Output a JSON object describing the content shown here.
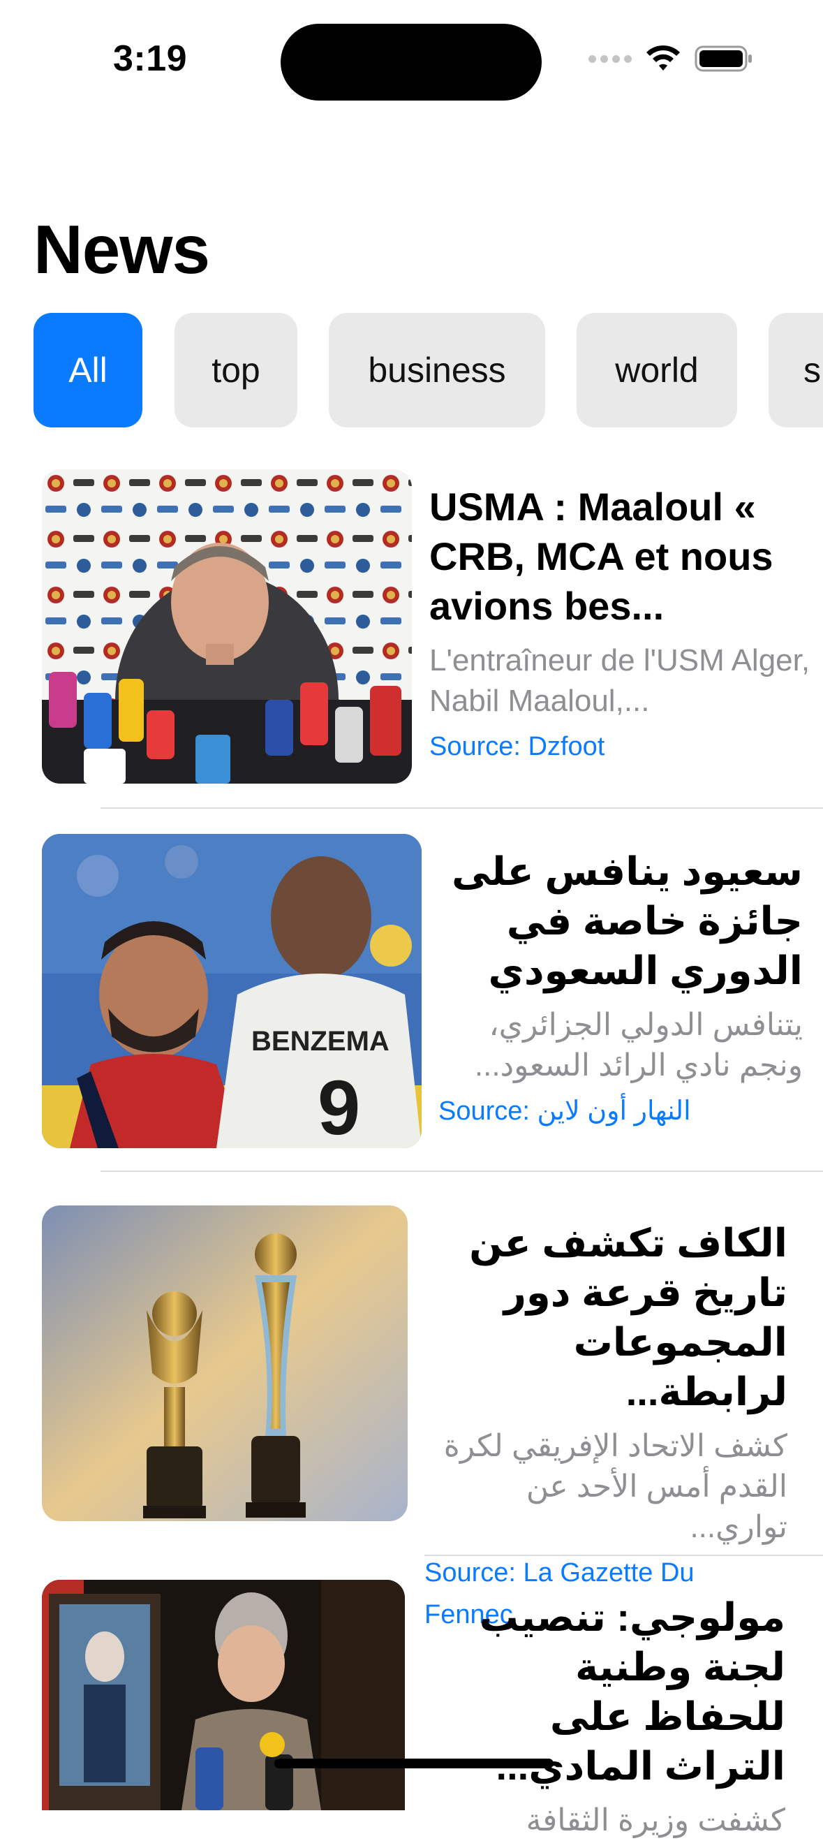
{
  "status_bar": {
    "time": "3:19",
    "icons": [
      "signal-dots-icon",
      "wifi-icon",
      "battery-icon"
    ]
  },
  "header": {
    "title": "News"
  },
  "categories": {
    "selected": "All",
    "items": [
      {
        "label": "All"
      },
      {
        "label": "top"
      },
      {
        "label": "business"
      },
      {
        "label": "world"
      },
      {
        "label": "sp"
      }
    ]
  },
  "articles": [
    {
      "title": "USMA : Maaloul « CRB, MCA et nous avions bes...",
      "summary": "L'entraîneur de l'USM Alger, Nabil Maaloul,...",
      "source": "Source: Dzfoot"
    },
    {
      "title": "سعيود ينافس على جائزة خاصة في الدوري السعودي",
      "summary": "يتنافس الدولي الجزائري، ونجم نادي الرائد السعود...",
      "source": "Source: النهار أون لاين"
    },
    {
      "title": "الكاف تكشف عن تاريخ قرعة دور المجموعات لرابطة...",
      "summary": "كشف الاتحاد الإفريقي لكرة القدم أمس الأحد عن تواري...",
      "source": "Source: La Gazette Du Fennec"
    },
    {
      "title": "مولوجي: تنصيب لجنة وطنية للحفاظ على التراث المادي...",
      "summary": "كشفت وزيرة الثقافة",
      "source": ""
    }
  ],
  "colors": {
    "accent": "#0a7bff",
    "chip_bg": "#e9e9ea",
    "secondary_text": "#8e8e93",
    "divider": "#dcdcdf"
  }
}
